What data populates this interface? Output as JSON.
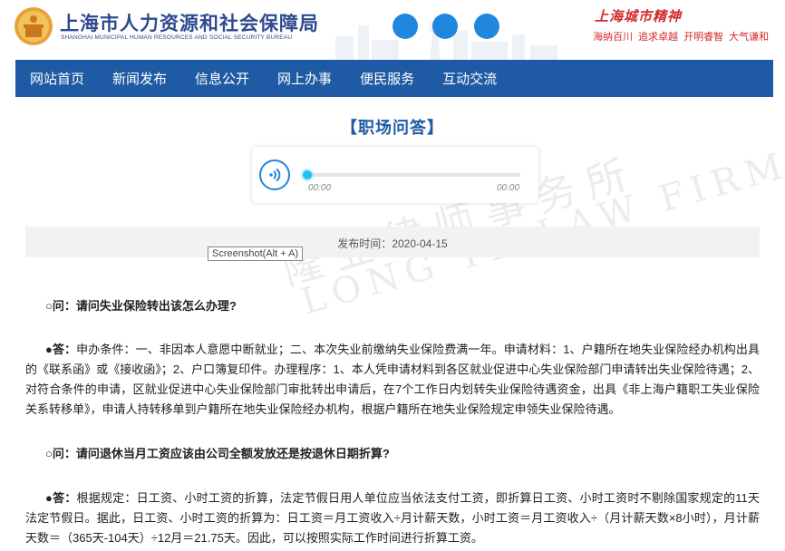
{
  "header": {
    "bureau_name_cn": "上海市人力资源和社会保障局",
    "bureau_name_en": "SHANGHAI MUNICIPAL HUMAN RESOURCES AND SOCIAL SECURITY BUREAU",
    "spirit_title": "上海城市精神",
    "spirit_words": "海纳百川 追求卓越 开明睿智 大气谦和",
    "brand_color": "#2e4a8e"
  },
  "nav": {
    "items": [
      {
        "label": "网站首页"
      },
      {
        "label": "新闻发布"
      },
      {
        "label": "信息公开"
      },
      {
        "label": "网上办事"
      },
      {
        "label": "便民服务"
      },
      {
        "label": "互动交流"
      }
    ],
    "background": "#1f5ba4"
  },
  "article": {
    "title": "【职场问答】",
    "audio": {
      "current_time": "00:00",
      "duration": "00:00",
      "progress": 0
    },
    "publish_label": "发布时间：",
    "publish_date": "2020-04-15",
    "tooltip": "Screenshot(Alt + A)",
    "watermark_cn": "隆业律师事务所",
    "watermark_en": "LONG YE LAW FIRM",
    "qa": [
      {
        "q_prefix": "○问：",
        "question": "请问失业保险转出该怎么办理?",
        "a_prefix": "●答：",
        "answer": "申办条件：一、非因本人意愿中断就业；二、本次失业前缴纳失业保险费满一年。申请材料：1、户籍所在地失业保险经办机构出具的《联系函》或《接收函》；2、户口簿复印件。办理程序：1、本人凭申请材料到各区就业促进中心失业保险部门申请转出失业保险待遇；2、对符合条件的申请，区就业促进中心失业保险部门审批转出申请后，在7个工作日内划转失业保险待遇资金，出具《非上海户籍职工失业保险关系转移单》，申请人持转移单到户籍所在地失业保险经办机构，根据户籍所在地失业保险规定申领失业保险待遇。"
      },
      {
        "q_prefix": "○问：",
        "question": "请问退休当月工资应该由公司全额发放还是按退休日期折算?",
        "a_prefix": "●答：",
        "answer": "根据规定：日工资、小时工资的折算，法定节假日用人单位应当依法支付工资，即折算日工资、小时工资时不剔除国家规定的11天法定节假日。据此，日工资、小时工资的折算为：日工资＝月工资收入÷月计薪天数，小时工资＝月工资收入÷（月计薪天数×8小时），月计薪天数＝（365天-104天）÷12月＝21.75天。因此，可以按照实际工作时间进行折算工资。"
      }
    ]
  }
}
